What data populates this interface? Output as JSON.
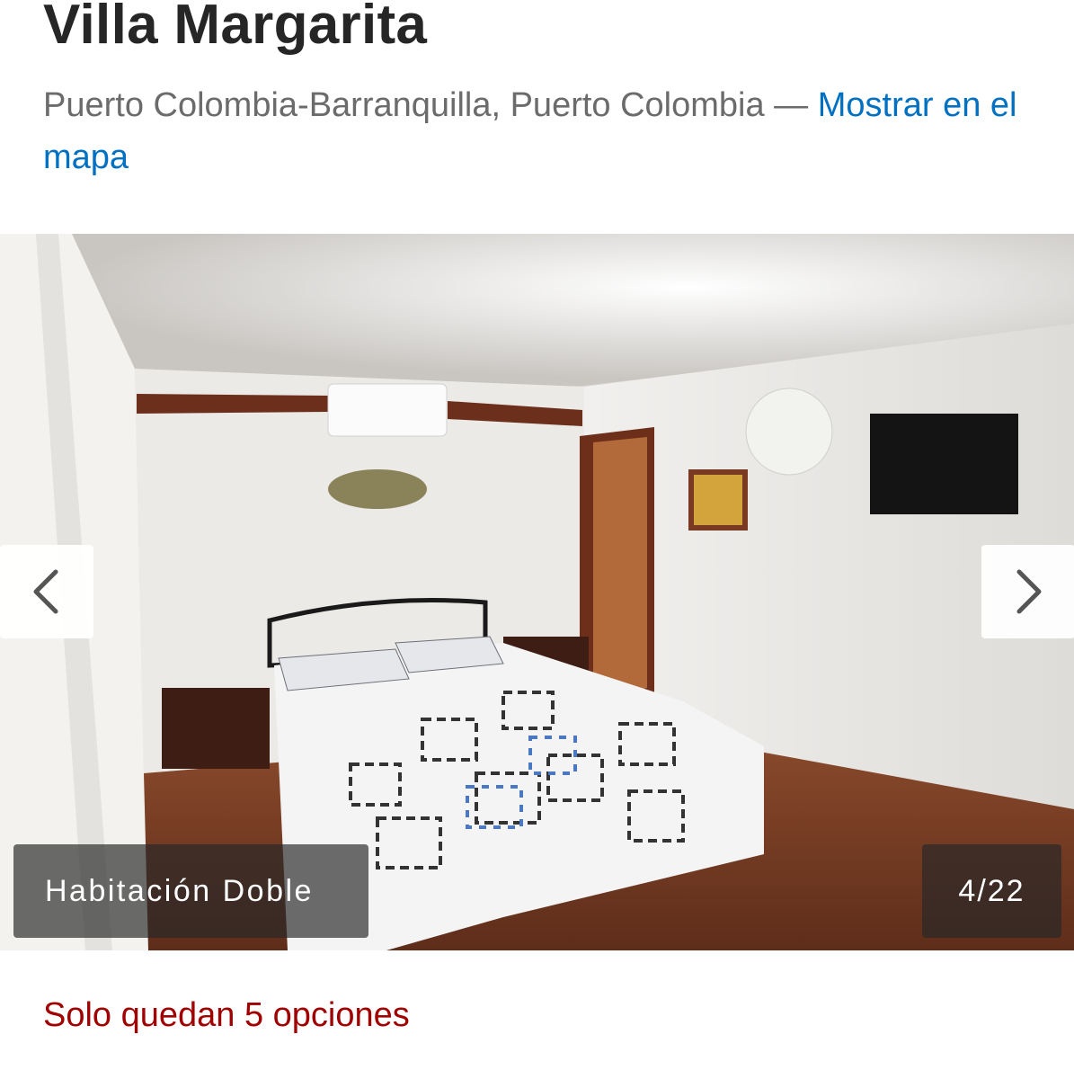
{
  "property": {
    "name": "Villa Margarita",
    "address": "Puerto Colombia-Barranquilla, Puerto Colombia — ",
    "map_link": "Mostrar en el mapa"
  },
  "gallery": {
    "caption": "Habitación Doble",
    "counter": "4/22",
    "prev_icon": "chevron-left-icon",
    "next_icon": "chevron-right-icon"
  },
  "availability": {
    "message": "Solo quedan 5 opciones"
  },
  "colors": {
    "link": "#0071c2",
    "urgency": "#a20000",
    "title": "#262626",
    "address": "#6b6b6b"
  }
}
